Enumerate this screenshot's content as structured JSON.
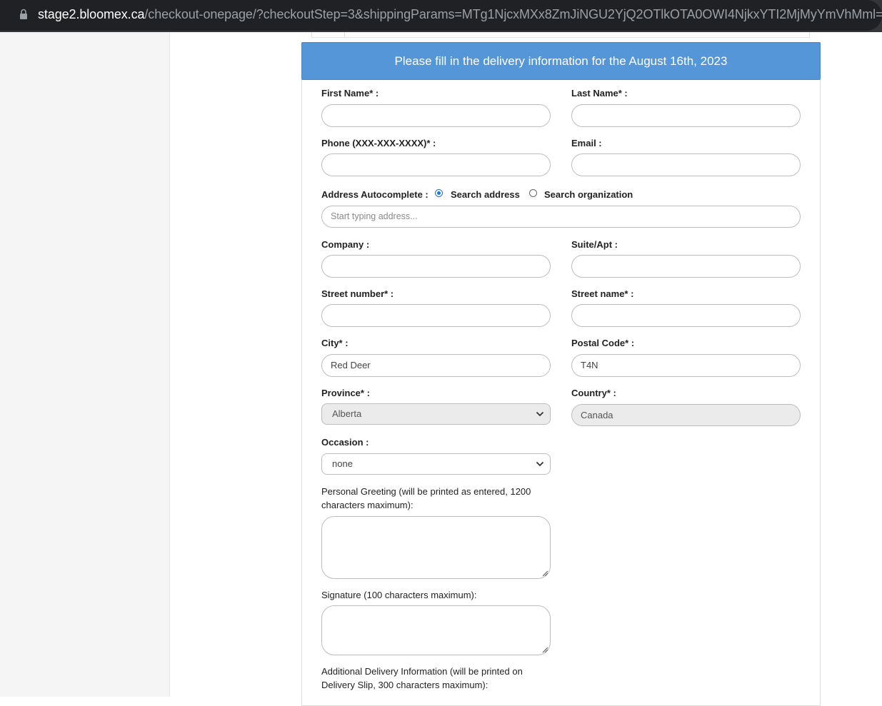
{
  "browser": {
    "url_host": "stage2.bloomex.ca",
    "url_path": "/checkout-onepage/?checkoutStep=3&shippingParams=MTg1NjcxMXx8ZmJiNGU2YjQ2OTlkOTA0OWI4NjkxYTI2MjMyYmVhMml="
  },
  "banner": "Please fill in the delivery information for the August 16th, 2023",
  "fields": {
    "first_name": {
      "label": "First Name* :",
      "value": ""
    },
    "last_name": {
      "label": "Last Name* :",
      "value": ""
    },
    "phone": {
      "label": "Phone (XXX-XXX-XXXX)* :",
      "value": ""
    },
    "email": {
      "label": "Email :",
      "value": ""
    },
    "address_autocomplete": {
      "label": "Address Autocomplete :",
      "option_address": "Search address",
      "option_organization": "Search organization",
      "selected": "Search address",
      "placeholder": "Start typing address..."
    },
    "company": {
      "label": "Company :",
      "value": ""
    },
    "suite": {
      "label": "Suite/Apt :",
      "value": ""
    },
    "street_number": {
      "label": "Street number* :",
      "value": ""
    },
    "street_name": {
      "label": "Street name* :",
      "value": ""
    },
    "city": {
      "label": "City* :",
      "value": "Red Deer"
    },
    "postal_code": {
      "label": "Postal Code* :",
      "value": "T4N"
    },
    "province": {
      "label": "Province* :",
      "value": "Alberta"
    },
    "country": {
      "label": "Country* :",
      "value": "Canada"
    },
    "occasion": {
      "label": "Occasion :",
      "value": "none"
    },
    "greeting": {
      "label": "Personal Greeting (will be printed as entered, 1200 characters maximum):"
    },
    "signature": {
      "label": "Signature (100 characters maximum):"
    },
    "additional_info": {
      "label": "Additional Delivery Information (will be printed on Delivery Slip, 300 characters maximum):"
    }
  },
  "colors": {
    "banner": "#5596d9",
    "radio_accent": "#1a73e8"
  }
}
